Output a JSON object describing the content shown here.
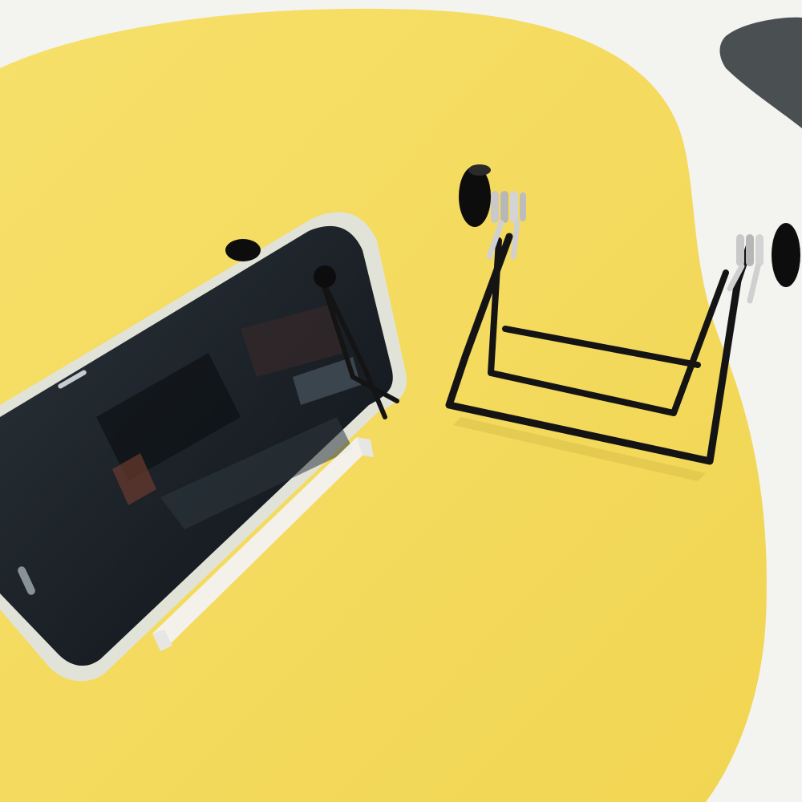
{
  "scene": {
    "colors": {
      "background": "#f3f3f0",
      "yellow_mat": "#f5dc5c",
      "dark_blob": "#4a4f52",
      "wire": "#141414",
      "spring": "#c9c9c9",
      "knob": "#0d0d0d",
      "phone_screen": "#1c2228",
      "phone_case": "#dfe3e6",
      "clear_stand": "#f2f2f0"
    },
    "objects": [
      {
        "name": "yellow-mat",
        "kind": "surface"
      },
      {
        "name": "smartphone",
        "kind": "device",
        "orientation": "landscape"
      },
      {
        "name": "folding-wire-stand-holding-phone",
        "kind": "stand"
      },
      {
        "name": "folding-wire-stand-empty",
        "kind": "stand"
      }
    ]
  }
}
